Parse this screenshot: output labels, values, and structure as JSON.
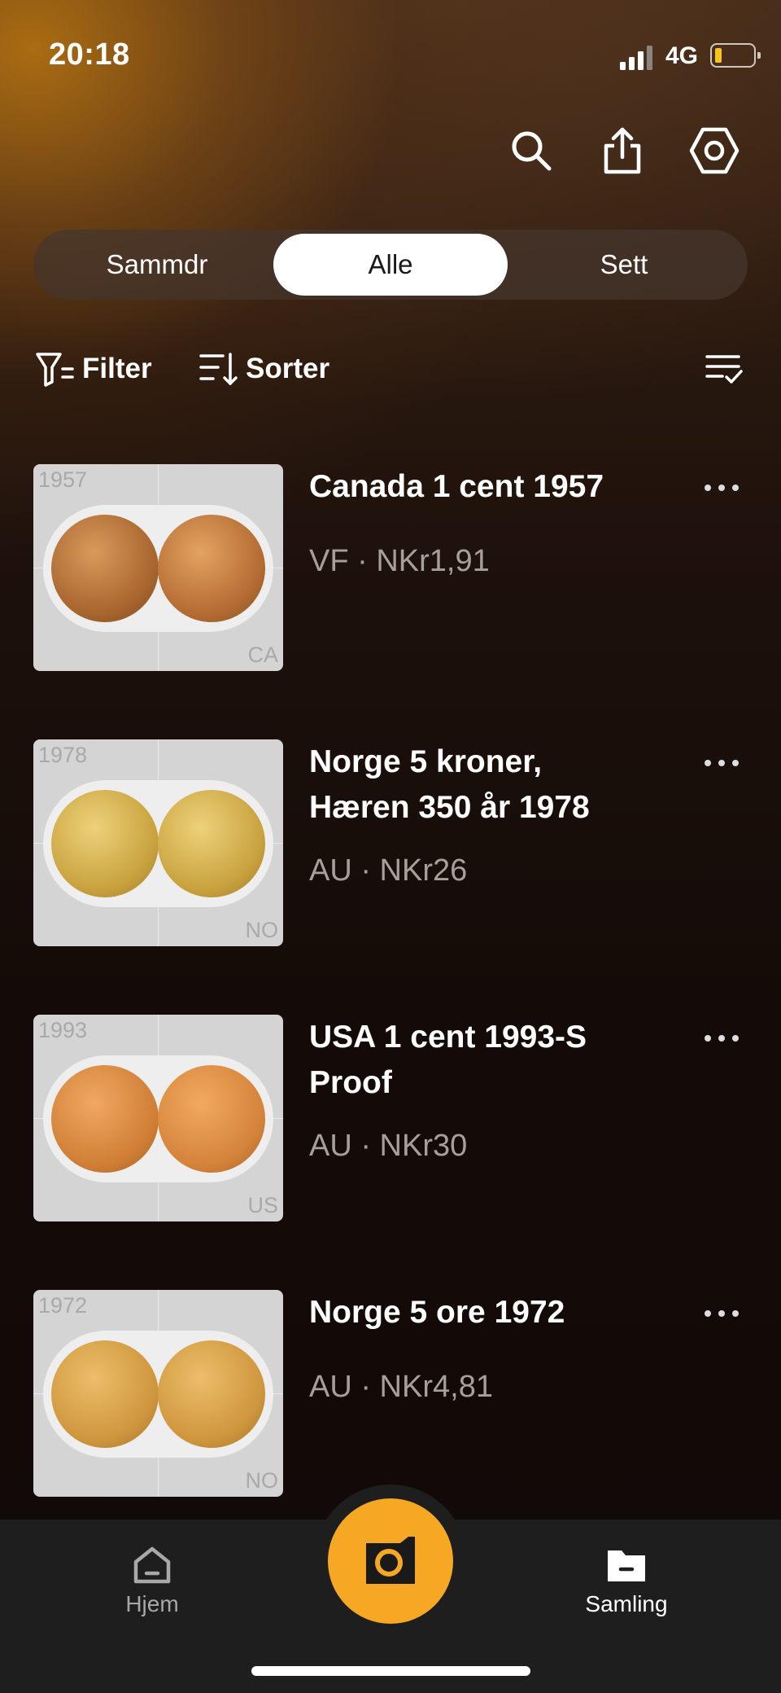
{
  "status_bar": {
    "time": "20:18",
    "network": "4G"
  },
  "segments": {
    "items": [
      "Sammdr",
      "Alle",
      "Sett"
    ],
    "active": "Alle"
  },
  "toolbar": {
    "filter_label": "Filter",
    "sort_label": "Sorter"
  },
  "coins": [
    {
      "title": "Canada 1 cent 1957",
      "grade": "VF",
      "price": "NKr1,91",
      "meta": "VF · NKr1,91",
      "year": "1957",
      "country_code": "CA",
      "coin_color": "#b8763a"
    },
    {
      "title": "Norge 5 kroner, Hæren 350 år 1978",
      "grade": "AU",
      "price": "NKr26",
      "meta": "AU · NKr26",
      "year": "1978",
      "country_code": "NO",
      "coin_color": "#d8b04a"
    },
    {
      "title": "USA 1 cent 1993-S Proof",
      "grade": "AU",
      "price": "NKr30",
      "meta": "AU · NKr30",
      "year": "1993",
      "country_code": "US",
      "coin_color": "#d88a3a"
    },
    {
      "title": "Norge 5 ore 1972",
      "grade": "AU",
      "price": "NKr4,81",
      "meta": "AU · NKr4,81",
      "year": "1972",
      "country_code": "NO",
      "coin_color": "#d4a044"
    }
  ],
  "tabbar": {
    "home_label": "Hjem",
    "collection_label": "Samling"
  },
  "colors": {
    "accent": "#f6a723",
    "active_segment_bg": "#ffffff",
    "meta_text": "#a6a09b"
  }
}
